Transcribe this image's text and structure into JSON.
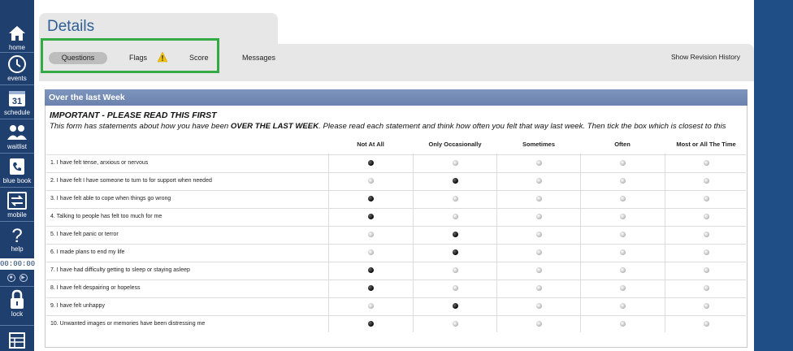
{
  "sidebar": {
    "items": [
      {
        "label": "home",
        "icon": "home-icon"
      },
      {
        "label": "events",
        "icon": "clock-icon"
      },
      {
        "label": "schedule",
        "icon": "calendar-icon",
        "calendar_day": "31"
      },
      {
        "label": "waitlist",
        "icon": "people-icon"
      },
      {
        "label": "blue book",
        "icon": "phone-book-icon"
      },
      {
        "label": "mobile",
        "icon": "sync-icon"
      },
      {
        "label": "help",
        "icon": "question-icon"
      },
      {
        "label": "lock",
        "icon": "lock-icon"
      }
    ],
    "timer": "00:00:00"
  },
  "header": {
    "title": "Details"
  },
  "tabs": {
    "questions": "Questions",
    "flags": "Flags",
    "score": "Score",
    "messages": "Messages",
    "revision": "Show Revision History"
  },
  "section": {
    "title": "Over the last Week",
    "important": "IMPORTANT - PLEASE READ THIS FIRST",
    "intro_pre": "This form has statements about how you have been ",
    "intro_bold": "OVER THE LAST WEEK",
    "intro_post": ". Please read each statement and think how often you felt that way last week. Then tick the box which is closest to this"
  },
  "columns": [
    "Not At All",
    "Only Occasionally",
    "Sometimes",
    "Often",
    "Most or All The Time"
  ],
  "questions": [
    {
      "label": "1. I have felt tense, anxious or nervous",
      "selected": 0
    },
    {
      "label": "2. I have felt I have someone to turn to for support when needed",
      "selected": 1
    },
    {
      "label": "3. I have felt able to cope when things go wrong",
      "selected": 0
    },
    {
      "label": "4. Talking to people has felt too much for me",
      "selected": 0
    },
    {
      "label": "5. I have felt panic or terror",
      "selected": 1
    },
    {
      "label": "6. I made plans to end my life",
      "selected": 1
    },
    {
      "label": "7. I have had difficulty getting to sleep or staying asleep",
      "selected": 0
    },
    {
      "label": "8. I have felt despairing or hopeless",
      "selected": 0
    },
    {
      "label": "9. I have felt unhappy",
      "selected": 1
    },
    {
      "label": "10. Unwanted images or memories have been distressing me",
      "selected": 0
    }
  ],
  "colors": {
    "sidebar": "#1f3f6e",
    "accent": "#2e5e96",
    "highlight": "#33aa44",
    "section_header": "#7088b2",
    "warning": "#f2c200"
  }
}
